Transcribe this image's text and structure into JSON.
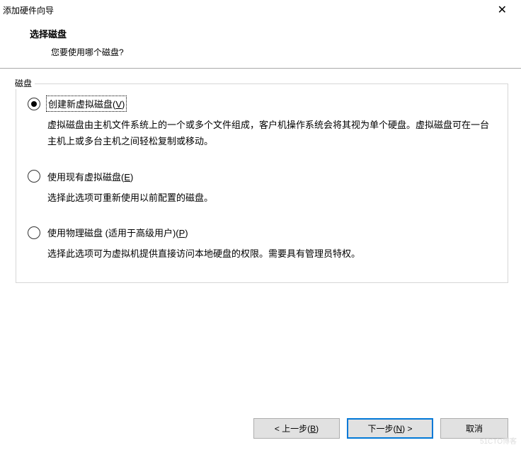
{
  "window": {
    "title": "添加硬件向导"
  },
  "header": {
    "title": "选择磁盘",
    "subtitle": "您要使用哪个磁盘?"
  },
  "groupbox": {
    "label": "磁盘"
  },
  "options": [
    {
      "label_prefix": "创建新虚拟磁盘(",
      "mnemonic": "V",
      "label_suffix": ")",
      "description": "虚拟磁盘由主机文件系统上的一个或多个文件组成，客户机操作系统会将其视为单个硬盘。虚拟磁盘可在一台主机上或多台主机之间轻松复制或移动。",
      "selected": true,
      "focused": true
    },
    {
      "label_prefix": "使用现有虚拟磁盘(",
      "mnemonic": "E",
      "label_suffix": ")",
      "description": "选择此选项可重新使用以前配置的磁盘。",
      "selected": false,
      "focused": false
    },
    {
      "label_prefix": "使用物理磁盘 (适用于高级用户)(",
      "mnemonic": "P",
      "label_suffix": ")",
      "description": "选择此选项可为虚拟机提供直接访问本地硬盘的权限。需要具有管理员特权。",
      "selected": false,
      "focused": false
    }
  ],
  "buttons": {
    "back_prefix": "< 上一步(",
    "back_mnemonic": "B",
    "back_suffix": ")",
    "next_prefix": "下一步(",
    "next_mnemonic": "N",
    "next_suffix": ") >",
    "cancel": "取消"
  },
  "watermark": "51CTO博客"
}
